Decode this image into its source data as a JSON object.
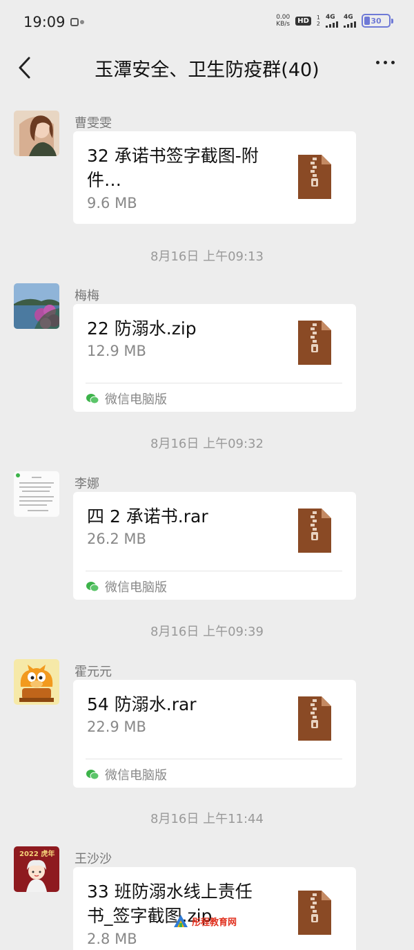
{
  "status_bar": {
    "time": "19:09",
    "net_speed_value": "0.00",
    "net_speed_unit": "KB/s",
    "hd": "HD",
    "sim_1": "1",
    "sim_2": "2",
    "signal_1": "4G",
    "signal_2": "4G",
    "battery_level": "30"
  },
  "header": {
    "back_icon": "chevron-left-icon",
    "title": "玉潭安全、卫生防疫群(40)",
    "more_icon": "more-dots-icon"
  },
  "messages": [
    {
      "sender": "曹雯雯",
      "file_name": "32 承诺书签字截图-附\n件…",
      "file_size": "9.6 MB",
      "source": ""
    },
    {
      "sender": "梅梅",
      "file_name": "22 防溺水.zip",
      "file_size": "12.9 MB",
      "source": "微信电脑版"
    },
    {
      "sender": "李娜",
      "file_name": "四 2 承诺书.rar",
      "file_size": "26.2 MB",
      "source": "微信电脑版"
    },
    {
      "sender": "霍元元",
      "file_name": "54 防溺水.rar",
      "file_size": "22.9 MB",
      "source": "微信电脑版"
    },
    {
      "sender": "王沙沙",
      "file_name": "33 班防溺水线上责任\n书_签字截图.zip",
      "file_size": "2.8 MB",
      "source": ""
    }
  ],
  "timestamps": [
    "8月16日 上午09:13",
    "8月16日 上午09:32",
    "8月16日 上午09:39",
    "8月16日 上午11:44"
  ],
  "avatars": {
    "msg_5_text": "2022 虎年"
  },
  "watermark": {
    "text": "彤程教育网"
  },
  "colors": {
    "background": "#ededed",
    "bubble": "#ffffff",
    "zip_icon": "#8a4a25",
    "wechat_green": "#3cb34a"
  }
}
